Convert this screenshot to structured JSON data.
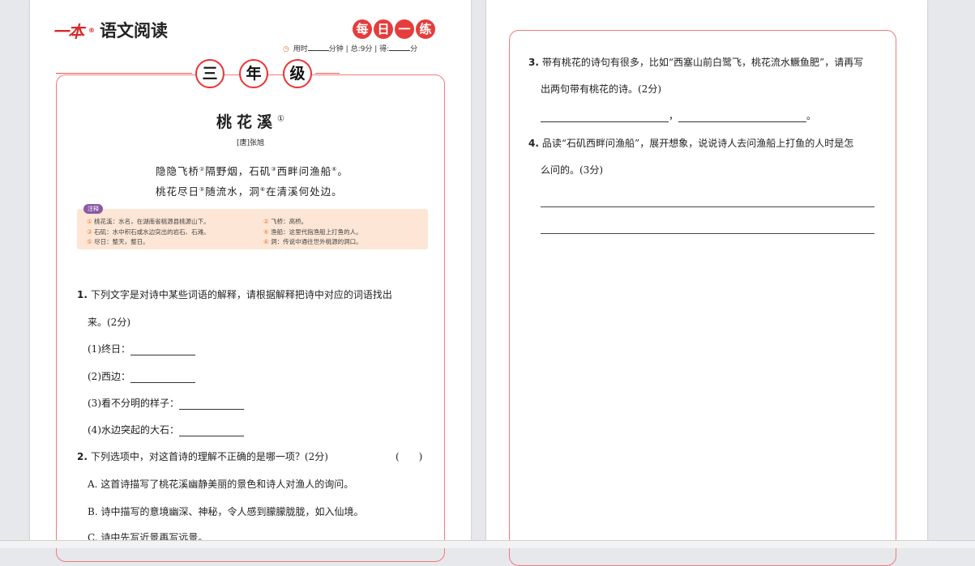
{
  "header": {
    "logo": "一本",
    "reg": "®",
    "series_title": "语文阅读",
    "daily": [
      "每",
      "日",
      "一",
      "练"
    ],
    "time_label": "用时",
    "time_unit": "分钟",
    "score_total": "总:9分",
    "score_label": "得:",
    "score_unit": "分"
  },
  "grade": [
    "三",
    "年",
    "级"
  ],
  "poem": {
    "title": "桃花溪",
    "title_note": "①",
    "author": "[唐]张旭",
    "lines": [
      {
        "a": "隐隐飞桥",
        "n1": "②",
        "b": "隔野烟，石矶",
        "n2": "③",
        "c": "西畔问渔船",
        "n3": "④",
        "d": "。"
      },
      {
        "a": "桃花尽日",
        "n1": "⑤",
        "b": "随流水，洞",
        "n2": "⑥",
        "c": "在清溪何处边。",
        "n3": "",
        "d": ""
      }
    ]
  },
  "notes": {
    "tag": "注释",
    "items": [
      {
        "num": "①",
        "text": "桃花溪：水名，在湖南省桃源县桃源山下。"
      },
      {
        "num": "②",
        "text": "飞桥：高桥。"
      },
      {
        "num": "③",
        "text": "石矶：水中积石或水边突出的岩石、石滩。"
      },
      {
        "num": "④",
        "text": "渔船：这里代指渔船上打鱼的人。"
      },
      {
        "num": "⑤",
        "text": "尽日：整天，整日。"
      },
      {
        "num": "⑥",
        "text": "洞：传说中通往世外桃源的洞口。"
      }
    ]
  },
  "questions": {
    "q1": {
      "num": "1.",
      "line1": "下列文字是对诗中某些词语的解释，请根据解释把诗中对应的词语找出",
      "line2": "来。(2分)",
      "items": [
        "(1)终日：",
        "(2)西边：",
        "(3)看不分明的样子：",
        "(4)水边突起的大石："
      ]
    },
    "q2": {
      "num": "2.",
      "stem": "下列选项中，对这首诗的理解不正确的是哪一项？(2分)",
      "paren": "(　　)",
      "options": [
        "A. 这首诗描写了桃花溪幽静美丽的景色和诗人对渔人的询问。",
        "B. 诗中描写的意境幽深、神秘，令人感到朦朦胧胧，如入仙境。",
        "C. 诗中先写近景再写远景。"
      ]
    },
    "q3": {
      "num": "3.",
      "line1": "带有桃花的诗句有很多，比如“西塞山前白鹭飞，桃花流水鳜鱼肥”，请再写",
      "line2": "出两句带有桃花的诗。(2分)",
      "comma": "，",
      "period": "。"
    },
    "q4": {
      "num": "4.",
      "line1": "品读“石矶西畔问渔船”，展开想象，说说诗人去问渔船上打鱼的人时是怎",
      "line2": "么问的。(3分)"
    }
  }
}
